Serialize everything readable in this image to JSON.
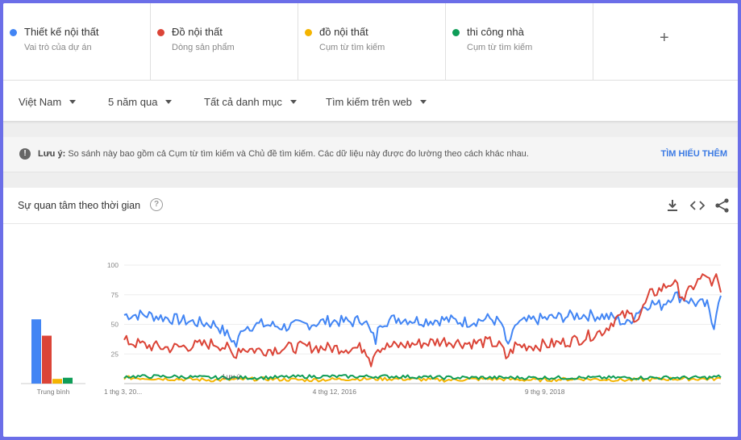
{
  "terms": [
    {
      "name": "Thiết kế nội thất",
      "subtitle": "Vai trò của dự án",
      "color": "#4285f4"
    },
    {
      "name": "Đồ nội thất",
      "subtitle": "Dòng sản phẩm",
      "color": "#db4437"
    },
    {
      "name": "đồ nội thất",
      "subtitle": "Cụm từ tìm kiếm",
      "color": "#f4b400"
    },
    {
      "name": "thi công nhà",
      "subtitle": "Cụm từ tìm kiếm",
      "color": "#0f9d58"
    }
  ],
  "add_label": "+",
  "filters": {
    "region": "Việt Nam",
    "period": "5 năm qua",
    "category": "Tất cả danh mục",
    "search_type": "Tìm kiếm trên web"
  },
  "note": {
    "label": "Lưu ý:",
    "text": "So sánh này bao gồm cả Cụm từ tìm kiếm và Chủ đề tìm kiếm. Các dữ liệu này được đo lường theo cách khác nhau.",
    "link": "TÌM HIỂU THÊM"
  },
  "card": {
    "title": "Sự quan tâm theo thời gian",
    "help": "?"
  },
  "chart_data": [
    {
      "type": "bar",
      "xlabel": "Trung bình",
      "categories": [
        "Thiết kế nội thất",
        "Đồ nội thất",
        "đồ nội thất",
        "thi công nhà"
      ],
      "values": [
        55,
        41,
        4,
        5
      ],
      "ylim": [
        0,
        100
      ],
      "colors": [
        "#4285f4",
        "#db4437",
        "#f4b400",
        "#0f9d58"
      ]
    },
    {
      "type": "line",
      "ylim": [
        0,
        100
      ],
      "yticks": [
        25,
        50,
        75,
        100
      ],
      "xticks": [
        {
          "label": "1 thg 3, 20...",
          "week": 0
        },
        {
          "label": "4 thg 12, 2016",
          "week": 92
        },
        {
          "label": "9 thg 9, 2018",
          "week": 184
        }
      ],
      "total_weeks": 261,
      "annotation": {
        "label": "Lưu ý",
        "week": 48
      },
      "grid": true,
      "series": [
        {
          "name": "Thiết kế nội thất",
          "color": "#4285f4",
          "keypoints": [
            [
              0,
              58
            ],
            [
              10,
              58
            ],
            [
              20,
              55
            ],
            [
              30,
              52
            ],
            [
              40,
              50
            ],
            [
              47,
              38
            ],
            [
              49,
              32
            ],
            [
              52,
              48
            ],
            [
              60,
              50
            ],
            [
              70,
              48
            ],
            [
              80,
              50
            ],
            [
              90,
              53
            ],
            [
              100,
              52
            ],
            [
              105,
              55
            ],
            [
              108,
              42
            ],
            [
              110,
              36
            ],
            [
              112,
              52
            ],
            [
              120,
              55
            ],
            [
              130,
              53
            ],
            [
              140,
              54
            ],
            [
              150,
              52
            ],
            [
              160,
              55
            ],
            [
              165,
              51
            ],
            [
              167,
              35
            ],
            [
              169,
              33
            ],
            [
              171,
              50
            ],
            [
              180,
              54
            ],
            [
              190,
              56
            ],
            [
              200,
              58
            ],
            [
              210,
              57
            ],
            [
              215,
              55
            ],
            [
              220,
              50
            ],
            [
              225,
              62
            ],
            [
              230,
              68
            ],
            [
              235,
              66
            ],
            [
              240,
              75
            ],
            [
              245,
              72
            ],
            [
              250,
              68
            ],
            [
              255,
              66
            ],
            [
              257,
              52
            ],
            [
              258,
              50
            ],
            [
              260,
              72
            ]
          ]
        },
        {
          "name": "Đồ nội thất",
          "color": "#db4437",
          "keypoints": [
            [
              0,
              36
            ],
            [
              5,
              34
            ],
            [
              10,
              32
            ],
            [
              20,
              30
            ],
            [
              30,
              32
            ],
            [
              40,
              34
            ],
            [
              45,
              30
            ],
            [
              47,
              25
            ],
            [
              48,
              22
            ],
            [
              50,
              30
            ],
            [
              60,
              28
            ],
            [
              70,
              30
            ],
            [
              80,
              31
            ],
            [
              90,
              30
            ],
            [
              100,
              30
            ],
            [
              105,
              30
            ],
            [
              107,
              25
            ],
            [
              108,
              18
            ],
            [
              110,
              30
            ],
            [
              120,
              32
            ],
            [
              130,
              34
            ],
            [
              140,
              36
            ],
            [
              150,
              34
            ],
            [
              160,
              35
            ],
            [
              165,
              31
            ],
            [
              167,
              22
            ],
            [
              169,
              26
            ],
            [
              171,
              32
            ],
            [
              180,
              32
            ],
            [
              190,
              34
            ],
            [
              200,
              38
            ],
            [
              210,
              45
            ],
            [
              215,
              55
            ],
            [
              220,
              58
            ],
            [
              225,
              56
            ],
            [
              230,
              75
            ],
            [
              235,
              80
            ],
            [
              240,
              86
            ],
            [
              245,
              72
            ],
            [
              250,
              85
            ],
            [
              255,
              92
            ],
            [
              257,
              80
            ],
            [
              259,
              90
            ],
            [
              261,
              76
            ]
          ]
        },
        {
          "name": "đồ nội thất",
          "color": "#f4b400",
          "keypoints": [
            [
              0,
              5
            ],
            [
              20,
              4
            ],
            [
              40,
              3
            ],
            [
              60,
              4
            ],
            [
              80,
              3
            ],
            [
              100,
              4
            ],
            [
              120,
              4
            ],
            [
              140,
              3
            ],
            [
              160,
              4
            ],
            [
              180,
              3
            ],
            [
              200,
              4
            ],
            [
              220,
              3
            ],
            [
              240,
              4
            ],
            [
              261,
              4
            ]
          ]
        },
        {
          "name": "thi công nhà",
          "color": "#0f9d58",
          "keypoints": [
            [
              0,
              6
            ],
            [
              20,
              6
            ],
            [
              40,
              5
            ],
            [
              60,
              5
            ],
            [
              80,
              6
            ],
            [
              100,
              6
            ],
            [
              120,
              6
            ],
            [
              140,
              5
            ],
            [
              160,
              5
            ],
            [
              180,
              5
            ],
            [
              200,
              5
            ],
            [
              220,
              5
            ],
            [
              240,
              5
            ],
            [
              255,
              5
            ],
            [
              261,
              6
            ]
          ]
        }
      ]
    }
  ]
}
